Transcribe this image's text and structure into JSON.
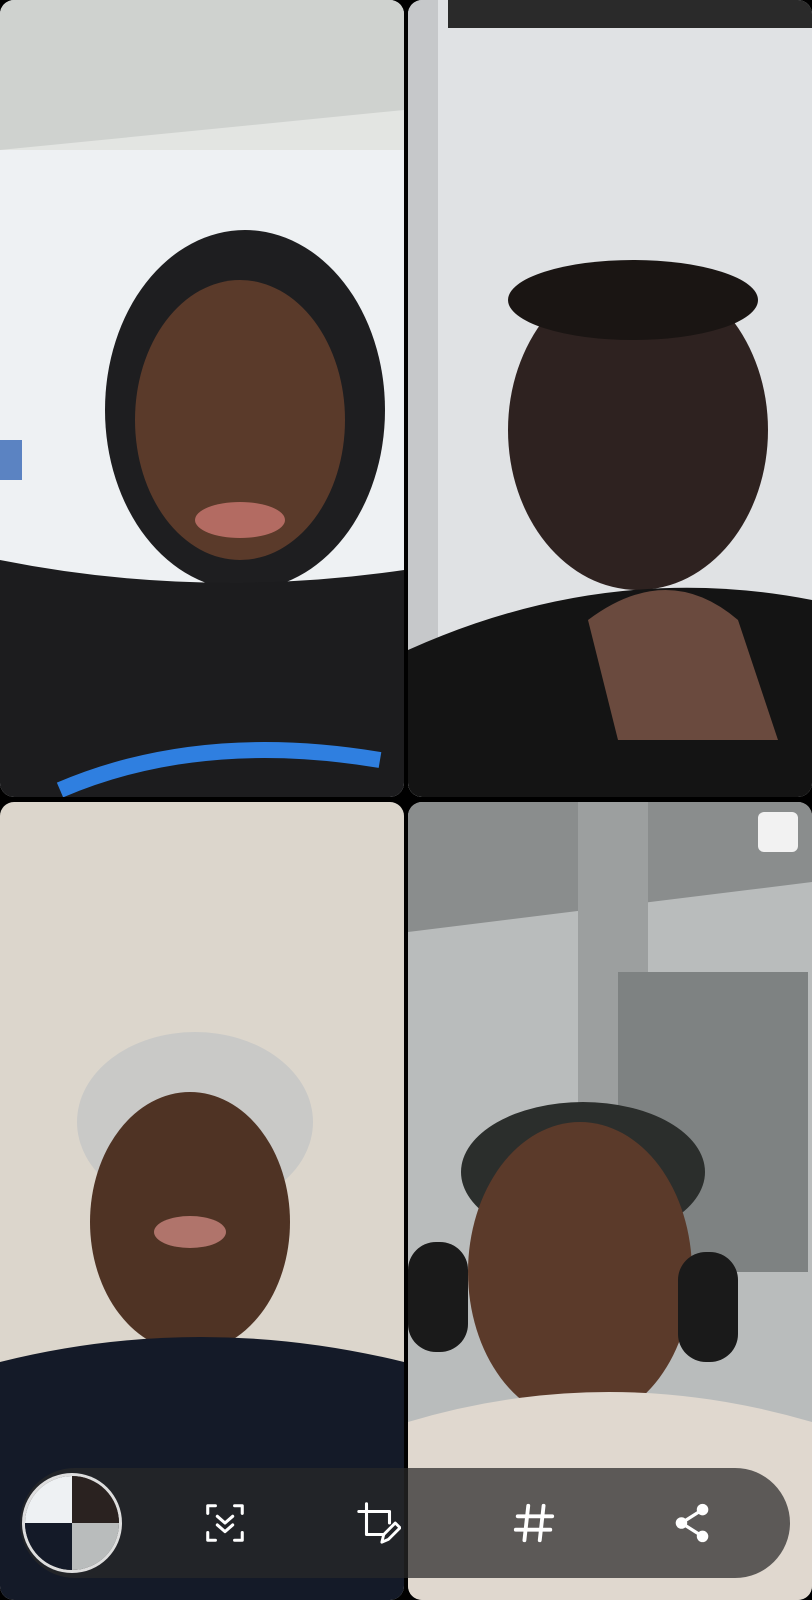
{
  "app": {
    "screen": "video-call-grid-screenshot"
  },
  "participants": [
    {
      "icon": "participant-video",
      "hat": "hood",
      "bg": "#e9ecef",
      "shirt": "#1b1b1b"
    },
    {
      "icon": "participant-video",
      "hat": "none",
      "bg": "#dcdcdc",
      "shirt": "#161616"
    },
    {
      "icon": "participant-video",
      "hat": "beanie-light",
      "bg": "#d8d2c8",
      "shirt": "#141a28"
    },
    {
      "icon": "participant-video",
      "hat": "beanie-dark",
      "bg": "#c8cac8",
      "shirt": "#e0d8cf"
    }
  ],
  "toolbar": {
    "thumbnail_icon": "screenshot-thumbnail",
    "actions": [
      {
        "icon": "scroll-capture-icon"
      },
      {
        "icon": "crop-edit-icon"
      },
      {
        "icon": "hashtag-icon"
      },
      {
        "icon": "share-icon"
      }
    ],
    "colors": {
      "background": "rgba(40,40,40,0.72)",
      "icon": "#ffffff"
    }
  }
}
